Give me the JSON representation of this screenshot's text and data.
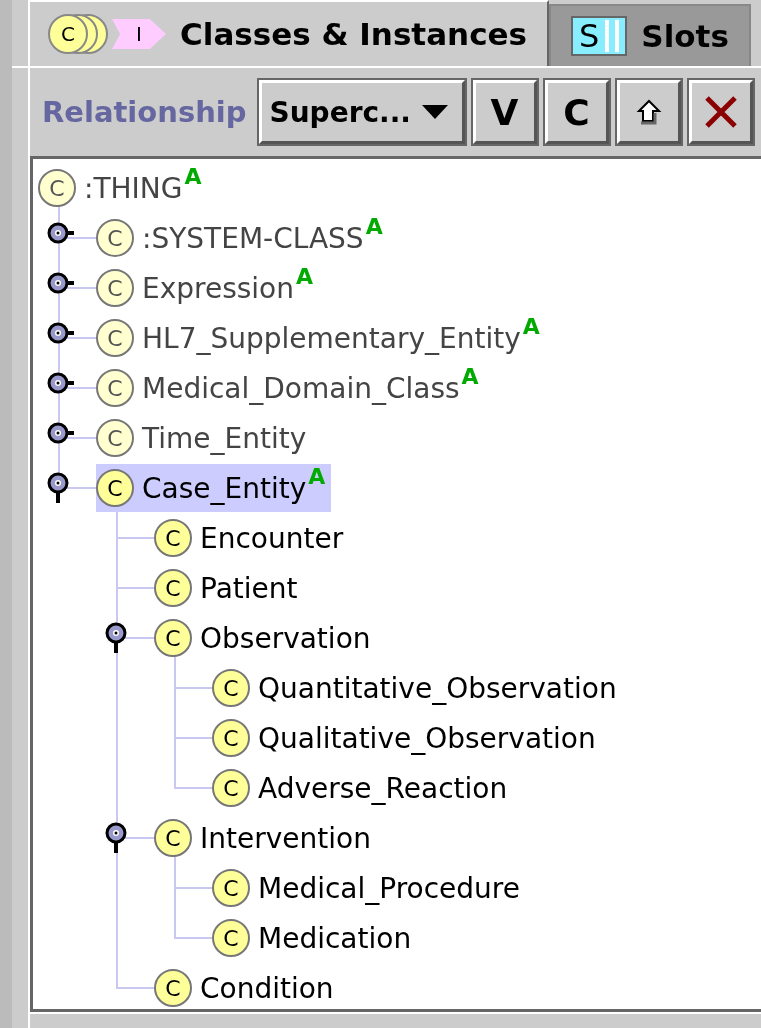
{
  "tabs": [
    {
      "label": "Classes & Instances",
      "icon_letters": [
        "C",
        "I"
      ],
      "selected": true
    },
    {
      "label": "Slots",
      "icon_letters": [
        "S"
      ],
      "selected": false
    }
  ],
  "toolbar": {
    "label": "Relationship",
    "dropdown": "Superc...",
    "buttons": [
      {
        "kind": "text",
        "label": "V"
      },
      {
        "kind": "text",
        "label": "C"
      },
      {
        "kind": "up-arrow"
      },
      {
        "kind": "delete"
      }
    ]
  },
  "tree": {
    "label": ":THING",
    "icon_letter": "C",
    "marker": "A",
    "greyed": true,
    "selected": false,
    "children": [
      {
        "label": ":SYSTEM-CLASS",
        "icon_letter": "C",
        "marker": "A",
        "greyed": true,
        "selected": false,
        "expanded": false
      },
      {
        "label": "Expression",
        "icon_letter": "C",
        "marker": "A",
        "greyed": true,
        "selected": false,
        "expanded": false
      },
      {
        "label": "HL7_Supplementary_Entity",
        "icon_letter": "C",
        "marker": "A",
        "greyed": true,
        "selected": false,
        "expanded": false
      },
      {
        "label": "Medical_Domain_Class",
        "icon_letter": "C",
        "marker": "A",
        "greyed": true,
        "selected": false,
        "expanded": false
      },
      {
        "label": "Time_Entity",
        "icon_letter": "C",
        "greyed": true,
        "selected": false,
        "expanded": false
      },
      {
        "label": "Case_Entity",
        "icon_letter": "C",
        "marker": "A",
        "greyed": false,
        "selected": true,
        "expanded": true,
        "children": [
          {
            "label": "Encounter",
            "icon_letter": "C",
            "greyed": false,
            "selected": false
          },
          {
            "label": "Patient",
            "icon_letter": "C",
            "greyed": false,
            "selected": false
          },
          {
            "label": "Observation",
            "icon_letter": "C",
            "greyed": false,
            "selected": false,
            "expanded": true,
            "children": [
              {
                "label": "Quantitative_Observation",
                "icon_letter": "C",
                "greyed": false,
                "selected": false
              },
              {
                "label": "Qualitative_Observation",
                "icon_letter": "C",
                "greyed": false,
                "selected": false
              },
              {
                "label": "Adverse_Reaction",
                "icon_letter": "C",
                "greyed": false,
                "selected": false
              }
            ]
          },
          {
            "label": "Intervention",
            "icon_letter": "C",
            "greyed": false,
            "selected": false,
            "expanded": true,
            "children": [
              {
                "label": "Medical_Procedure",
                "icon_letter": "C",
                "greyed": false,
                "selected": false
              },
              {
                "label": "Medication",
                "icon_letter": "C",
                "greyed": false,
                "selected": false
              }
            ]
          },
          {
            "label": "Condition",
            "icon_letter": "C",
            "greyed": false,
            "selected": false
          }
        ]
      }
    ]
  }
}
